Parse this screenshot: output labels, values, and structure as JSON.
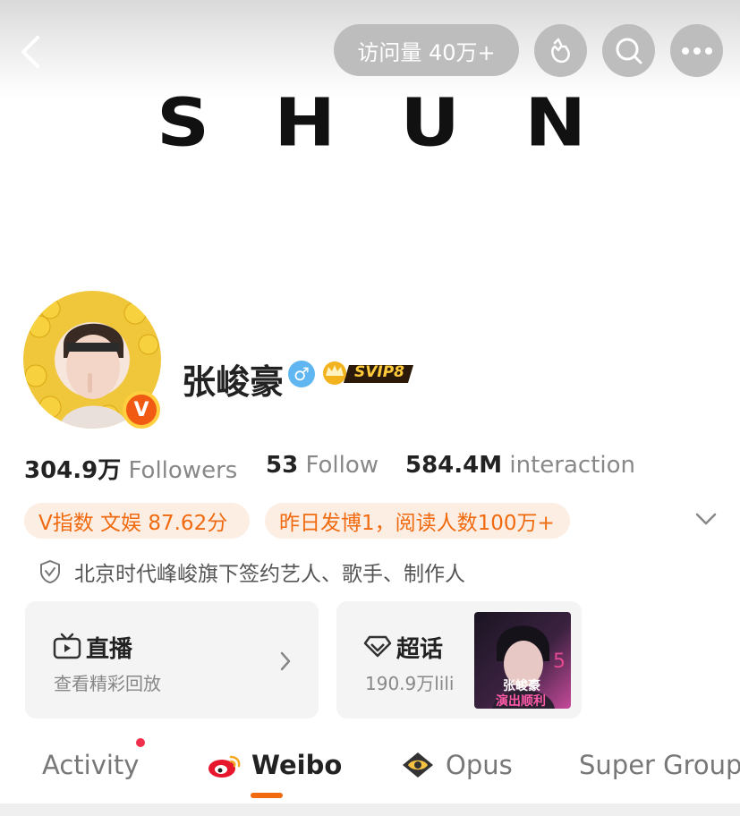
{
  "header": {
    "visits_label": "访问量 40万+",
    "banner_letters": [
      "S",
      "H",
      "U",
      "N"
    ]
  },
  "profile": {
    "name": "张峻豪",
    "gender_symbol": "♂",
    "svip_label": "SVIP8",
    "badge": "V"
  },
  "stats": {
    "followers_value": "304.9万",
    "followers_label": "Followers",
    "follow_value": "53",
    "follow_label": "Follow",
    "interaction_value": "584.4M",
    "interaction_label": "interaction"
  },
  "chips": {
    "v_index": "V指数 文娱 87.62分",
    "yesterday": "昨日发博1，阅读人数100万+"
  },
  "verify_text": "北京时代峰峻旗下签约艺人、歌手、制作人",
  "cards": {
    "live": {
      "title": "直播",
      "subtitle": "查看精彩回放"
    },
    "topic": {
      "title": "超话",
      "subtitle": "190.9万lili",
      "thumb_text_1": "张峻豪",
      "thumb_text_2": "演出顺利"
    }
  },
  "tabs": [
    {
      "label": "Activity"
    },
    {
      "label": "Weibo"
    },
    {
      "label": "Opus"
    },
    {
      "label": "Super Group"
    }
  ],
  "colors": {
    "accent": "#f26a0f",
    "chip_bg": "#fdeee4",
    "button_bg": "#bdbdbd"
  }
}
